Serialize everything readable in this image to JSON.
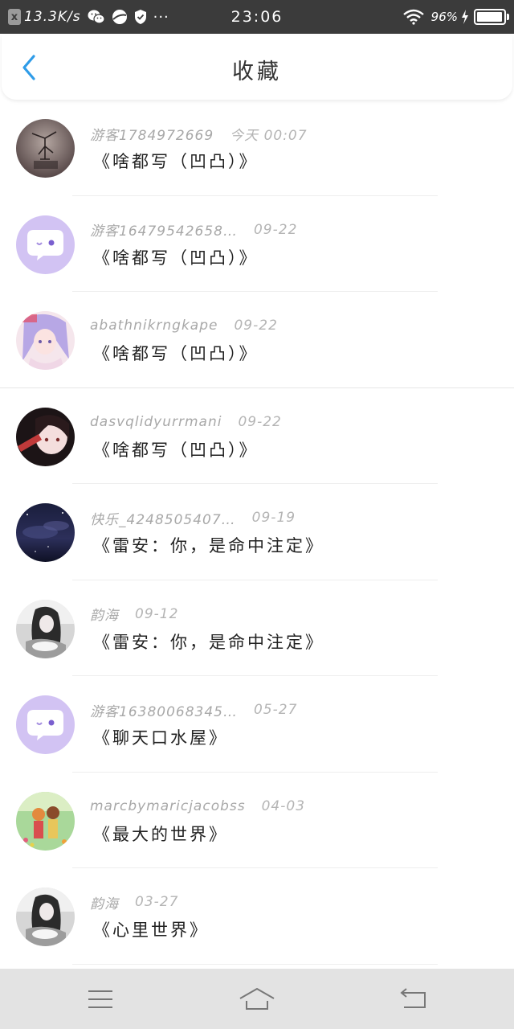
{
  "status_bar": {
    "notification_badge": "x",
    "net_speed": "13.3K/s",
    "more": "···",
    "time": "23:06",
    "battery_percent": "96%",
    "battery_level": 0.96
  },
  "header": {
    "title": "收藏",
    "accent_color": "#2f9ce8"
  },
  "favorites": [
    {
      "author": "游客1784972669",
      "time": "今天 00:07",
      "title": "《啥都写（凹凸）》",
      "avatar": "sketch-figure"
    },
    {
      "author": "游客16479542658…",
      "time": "09-22",
      "title": "《啥都写（凹凸）》",
      "avatar": "default-chat-bubble"
    },
    {
      "author": "abathnikrngkape",
      "time": "09-22",
      "title": "《啥都写（凹凸）》",
      "avatar": "anime-girl-pink"
    },
    {
      "author": "dasvqlidyurrmani",
      "time": "09-22",
      "title": "《啥都写（凹凸）》",
      "avatar": "anime-girl-dark"
    },
    {
      "author": "快乐_4248505407…",
      "time": "09-19",
      "title": "《雷安：你，是命中注定》",
      "avatar": "night-sky"
    },
    {
      "author": "韵海",
      "time": "09-12",
      "title": "《雷安：你，是命中注定》",
      "avatar": "bw-girl"
    },
    {
      "author": "游客16380068345…",
      "time": "05-27",
      "title": "《聊天口水屋》",
      "avatar": "default-chat-bubble"
    },
    {
      "author": "marcbymaricjacobss",
      "time": "04-03",
      "title": "《最大的世界》",
      "avatar": "couple-illustration"
    },
    {
      "author": "韵海",
      "time": "03-27",
      "title": "《心里世界》",
      "avatar": "bw-girl"
    }
  ],
  "nav_bar": {
    "menu_icon": "menu-icon",
    "home_icon": "home-icon",
    "back_icon": "back-icon"
  }
}
